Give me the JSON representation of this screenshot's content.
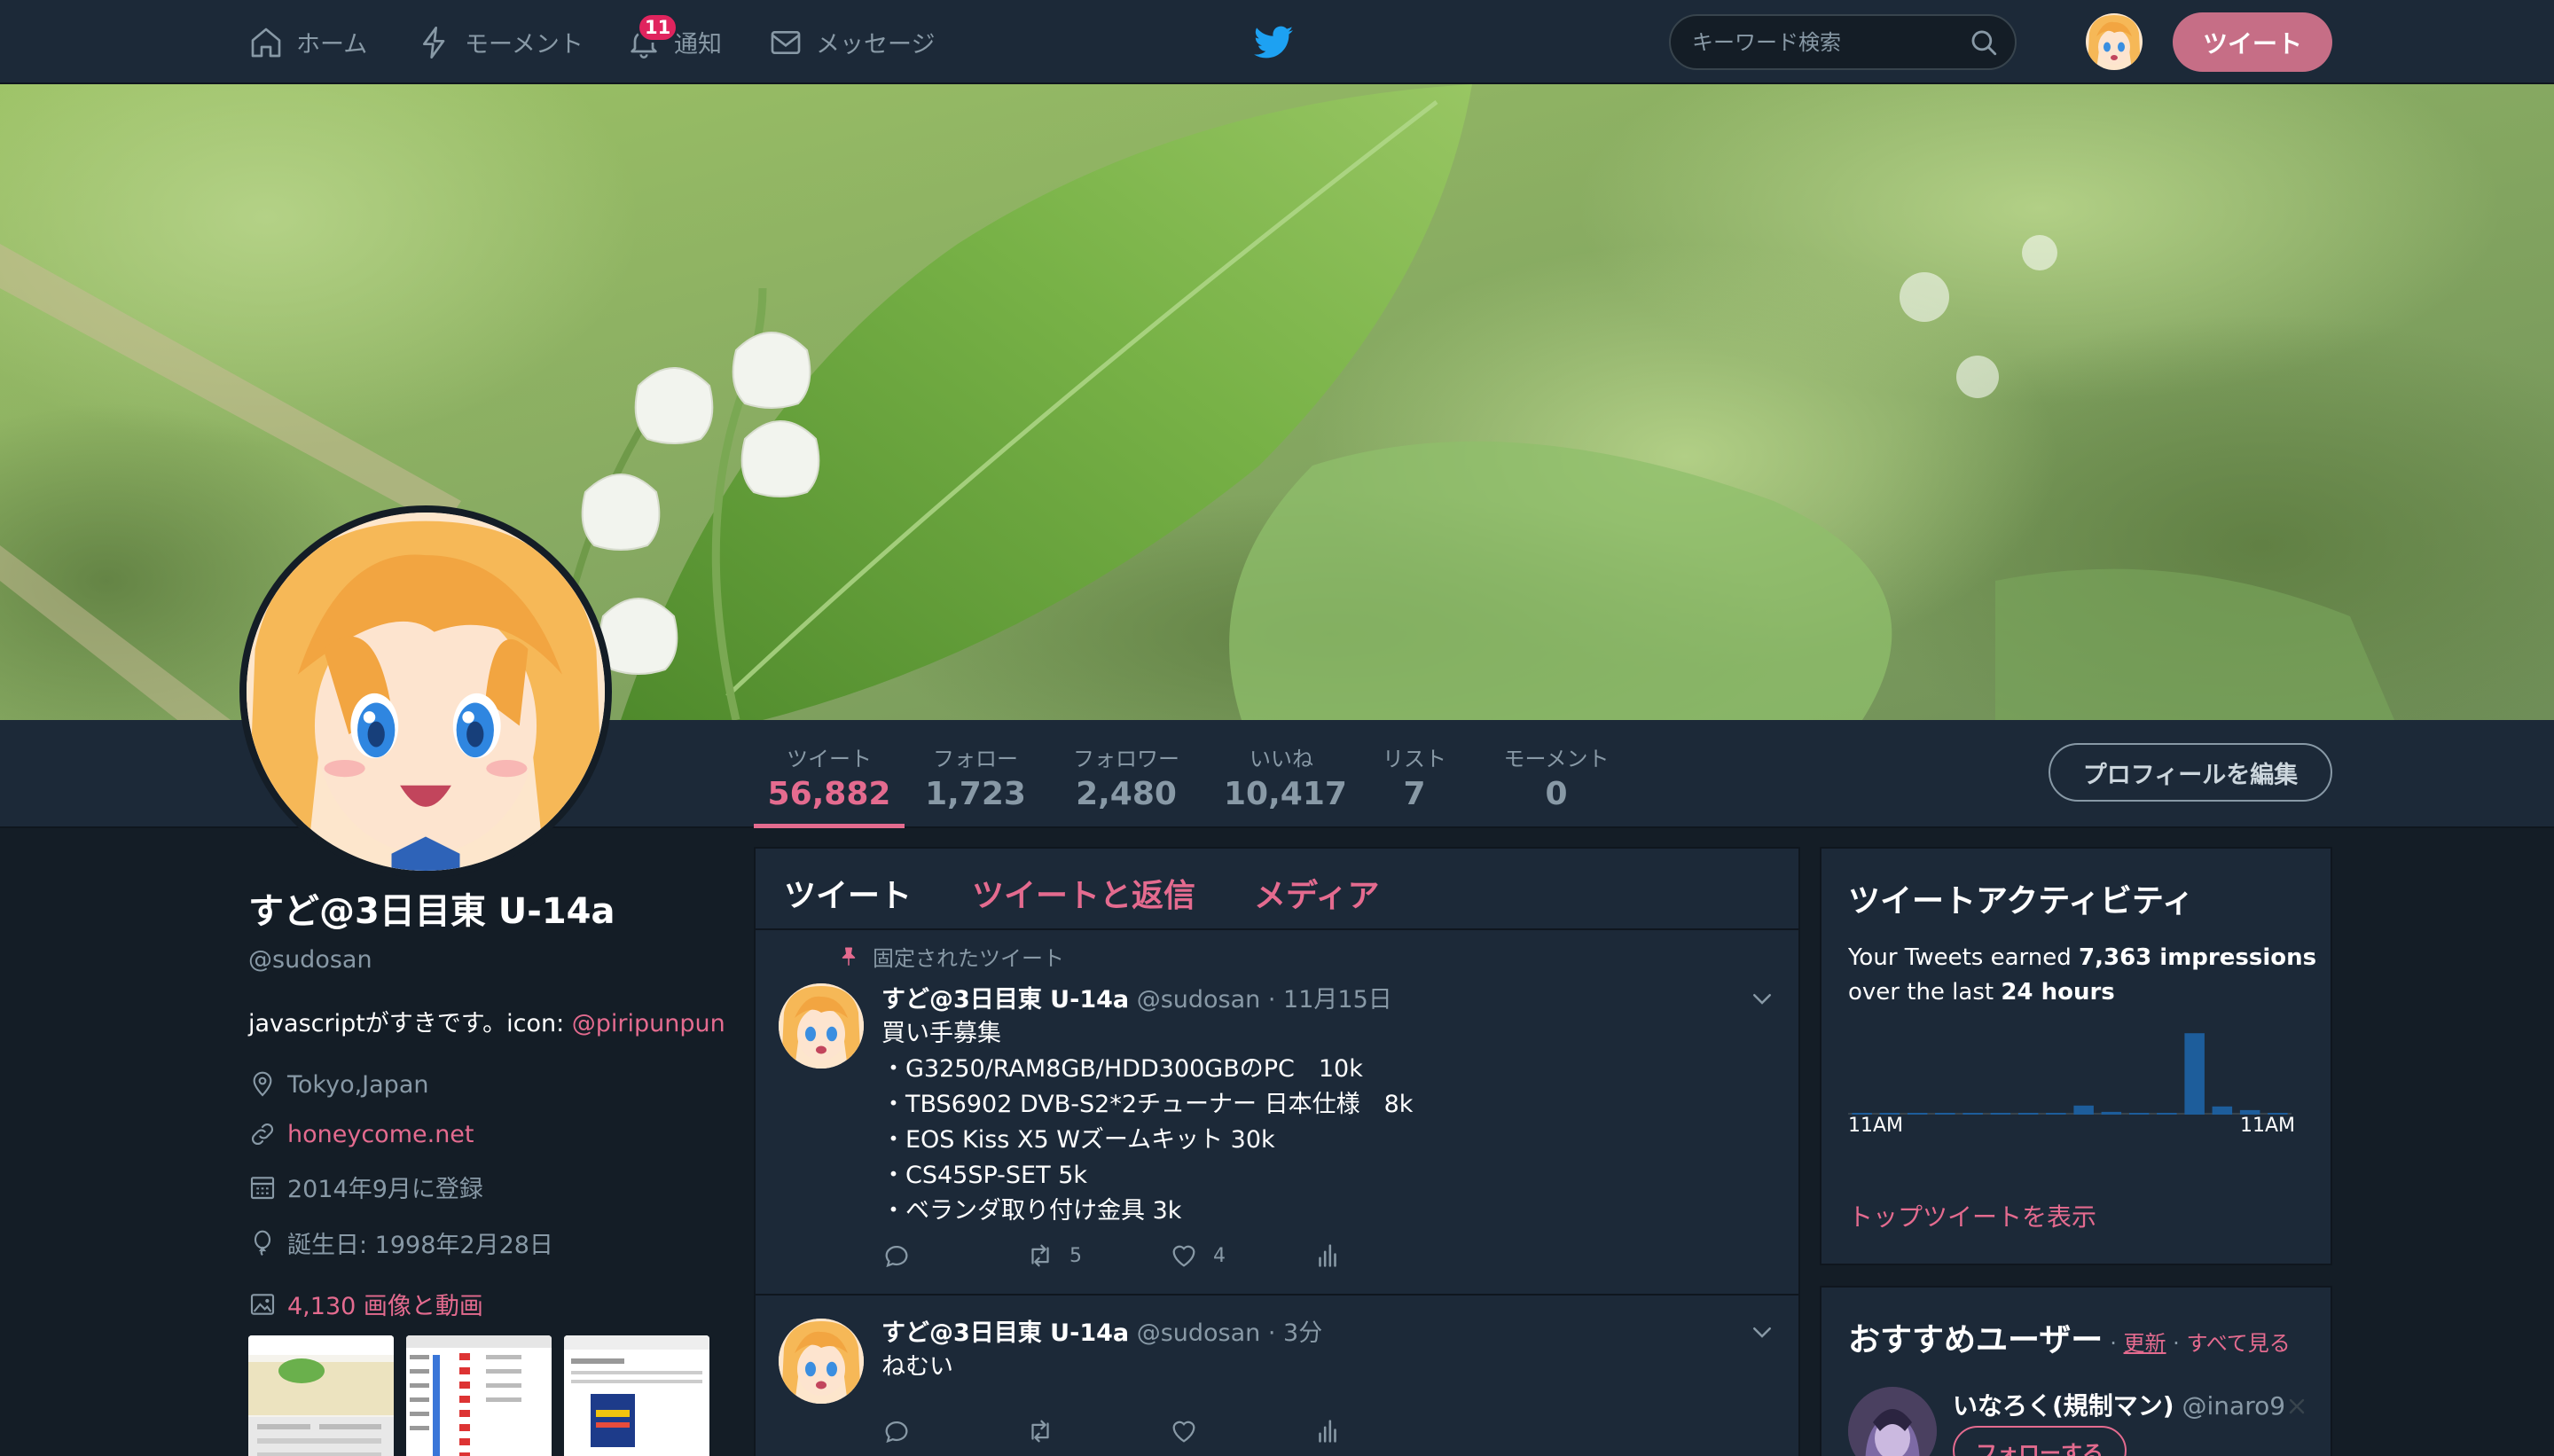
{
  "nav": {
    "home": "ホーム",
    "moments": "モーメント",
    "notifications": "通知",
    "notifications_badge": "11",
    "messages": "メッセージ",
    "search_placeholder": "キーワード検索",
    "tweet_button": "ツイート"
  },
  "colors": {
    "accent": "#e46b8f",
    "tweet_button": "#c66e86",
    "background": "#141d26",
    "panel": "#1c2938",
    "muted_text": "#8899a6"
  },
  "stats": [
    {
      "label": "ツイート",
      "value": "56,882"
    },
    {
      "label": "フォロー",
      "value": "1,723"
    },
    {
      "label": "フォロワー",
      "value": "2,480"
    },
    {
      "label": "いいね",
      "value": "10,417"
    },
    {
      "label": "リスト",
      "value": "7"
    },
    {
      "label": "モーメント",
      "value": "0"
    }
  ],
  "edit_profile": "プロフィールを編集",
  "profile": {
    "name": "すど@3日目東 U-14a",
    "handle": "@sudosan",
    "bio_text": "javascriptがすきです。icon: ",
    "bio_link": "@piripunpun",
    "location": "Tokyo,Japan",
    "website": "honeycome.net",
    "joined": "2014年9月に登録",
    "birthday": "誕生日: 1998年2月28日",
    "media_count": "4,130 画像と動画"
  },
  "timeline": {
    "tabs": [
      "ツイート",
      "ツイートと返信",
      "メディア"
    ],
    "pinned_label": "固定されたツイート",
    "tweets": [
      {
        "name": "すど@3日目東 U-14a",
        "handle": "@sudosan",
        "time": "· 11月15日",
        "lines": [
          "買い手募集",
          "・G3250/RAM8GB/HDD300GBのPC　10k",
          "・TBS6902 DVB-S2*2チューナー 日本仕様　8k",
          "・EOS Kiss X5 Wズームキット 30k",
          "・CS45SP-SET 5k",
          "・ベランダ取り付け金具 3k"
        ],
        "retweets": "5",
        "likes": "4"
      },
      {
        "name": "すど@3日目東 U-14a",
        "handle": "@sudosan",
        "time": "· 3分",
        "lines": [
          "ねむい"
        ],
        "retweets": "",
        "likes": ""
      }
    ]
  },
  "activity": {
    "title": "ツイートアクティビティ",
    "line1_prefix": "Your Tweets earned ",
    "impressions": "7,363 impressions",
    "line2_prefix": "over the last ",
    "period": "24 hours",
    "axis_start": "11AM",
    "axis_end": "11AM",
    "link": "トップツイートを表示"
  },
  "chart_data": {
    "type": "bar",
    "title": "",
    "xlabel": "",
    "ylabel": "",
    "x_start_label": "11AM",
    "x_end_label": "11AM",
    "values": [
      0.02,
      0.02,
      0.02,
      0.0,
      0.0,
      0.02,
      0.0,
      0.0,
      0.1,
      0.03,
      0.0,
      0.0,
      0.9,
      0.09,
      0.05,
      0.02
    ],
    "color": "#1d5d9b"
  },
  "suggest": {
    "title": "おすすめユーザー",
    "refresh": "更新",
    "see_all": "すべて見る",
    "user_name": "いなろく(規制マン)",
    "user_handle": "@inaro9",
    "follow": "フォローする"
  }
}
